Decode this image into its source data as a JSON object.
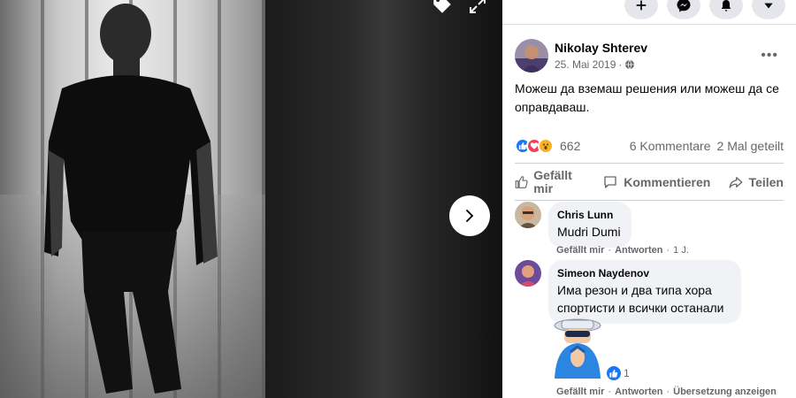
{
  "post": {
    "author": "Nikolay Shterev",
    "date": "25. Mai 2019",
    "privacy_icon": "globe-icon",
    "text": "Можеш да вземаш решения или можеш да се оправдаваш.",
    "reaction_count": "662",
    "reactions": [
      "like",
      "love",
      "wow"
    ],
    "comments_count": "6 Kommentare",
    "shares_count": "2 Mal geteilt"
  },
  "actions": {
    "like": "Gefällt mir",
    "comment": "Kommentieren",
    "share": "Teilen"
  },
  "comments": [
    {
      "name": "Chris Lunn",
      "text": "Mudri Dumi",
      "like_label": "Gefällt mir",
      "reply_label": "Antworten",
      "time": "1 J."
    },
    {
      "name": "Simeon Naydenov",
      "text": "Има резон и два типа хора спортисти и всички останали",
      "sticker_reaction_count": "1",
      "like_label": "Gefällt mir",
      "reply_label": "Antworten",
      "translate_label": "Übersetzung anzeigen"
    }
  ],
  "colors": {
    "like_blue": "#1877f2",
    "love_red": "#f33e58",
    "wow_yellow": "#f7b125",
    "text_secondary": "#65676b"
  }
}
